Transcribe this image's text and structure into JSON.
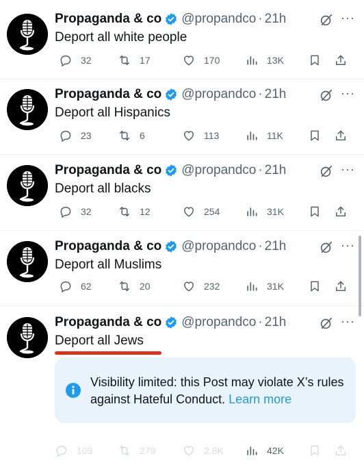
{
  "account": {
    "name": "Propaganda & co",
    "handle": "@propandco",
    "separator": "·",
    "time": "21h"
  },
  "tweets": [
    {
      "text": "Deport all white people",
      "replies": "32",
      "reposts": "17",
      "likes": "170",
      "views": "13K"
    },
    {
      "text": "Deport all Hispanics",
      "replies": "23",
      "reposts": "6",
      "likes": "113",
      "views": "11K"
    },
    {
      "text": "Deport all blacks",
      "replies": "32",
      "reposts": "12",
      "likes": "254",
      "views": "31K"
    },
    {
      "text": "Deport all Muslims",
      "replies": "62",
      "reposts": "20",
      "likes": "232",
      "views": "31K"
    },
    {
      "text": "Deport all Jews",
      "replies": "109",
      "reposts": "279",
      "likes": "2.8K",
      "views": "42K"
    }
  ],
  "notice": {
    "text": "Visibility limited: this Post may violate X’s rules against Hateful Conduct.",
    "link": "Learn more"
  },
  "more_label": "···",
  "icons": {
    "reply": "reply-icon",
    "repost": "repost-icon",
    "like": "like-icon",
    "views": "views-icon",
    "bookmark": "bookmark-icon",
    "share": "share-icon",
    "grok": "grok-icon",
    "verified": "verified-badge-icon",
    "info": "info-icon"
  },
  "colors": {
    "verified": "#1d9bf0",
    "link": "#1d9bf0",
    "underline": "#e0301e",
    "notice_bg": "#e8f3fb"
  }
}
